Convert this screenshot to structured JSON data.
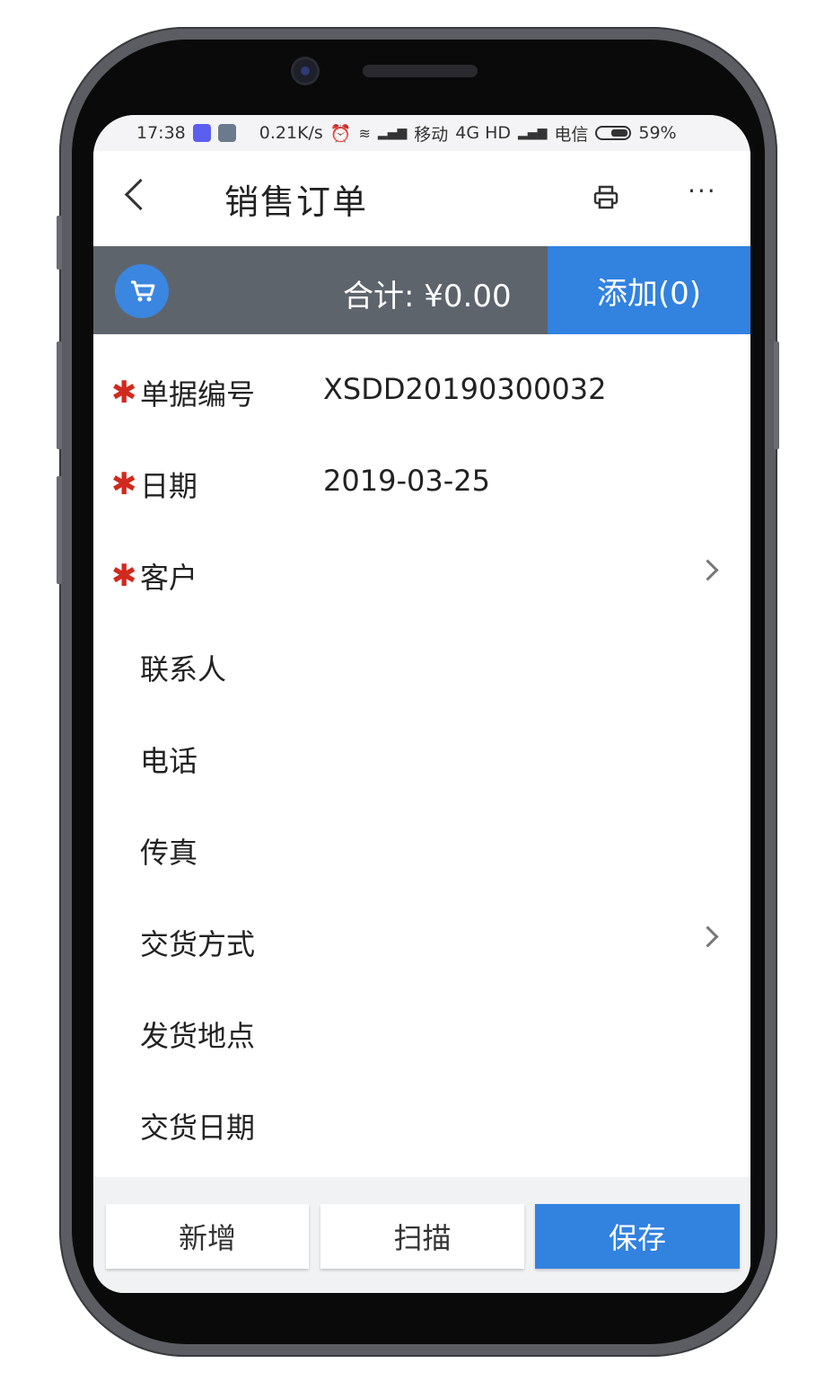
{
  "status_bar": {
    "time": "17:38",
    "speed": "0.21K/s",
    "carrier1": "移动",
    "network": "4G HD",
    "carrier2": "电信",
    "battery": "59%"
  },
  "nav": {
    "title": "销售订单",
    "more": "···"
  },
  "summary": {
    "total_text": "合计: ¥0.00",
    "add_button": "添加(0)"
  },
  "form": {
    "fields": [
      {
        "label": "单据编号",
        "value": "XSDD20190300032",
        "required": true
      },
      {
        "label": "日期",
        "value": "2019-03-25",
        "required": true
      },
      {
        "label": "客户",
        "value": "",
        "required": true
      },
      {
        "label": "联系人",
        "value": "",
        "required": false
      },
      {
        "label": "电话",
        "value": "",
        "required": false
      },
      {
        "label": "传真",
        "value": "",
        "required": false
      },
      {
        "label": "交货方式",
        "value": "",
        "required": false
      },
      {
        "label": "发货地点",
        "value": "",
        "required": false
      },
      {
        "label": "交货日期",
        "value": "",
        "required": false
      }
    ],
    "required_mark": "✱"
  },
  "bottom": {
    "new_button": "新增",
    "scan_button": "扫描",
    "save_button": "保存"
  },
  "colors": {
    "accent": "#3282e0",
    "summary_bar": "#5e646c",
    "required": "#d02a1f"
  }
}
